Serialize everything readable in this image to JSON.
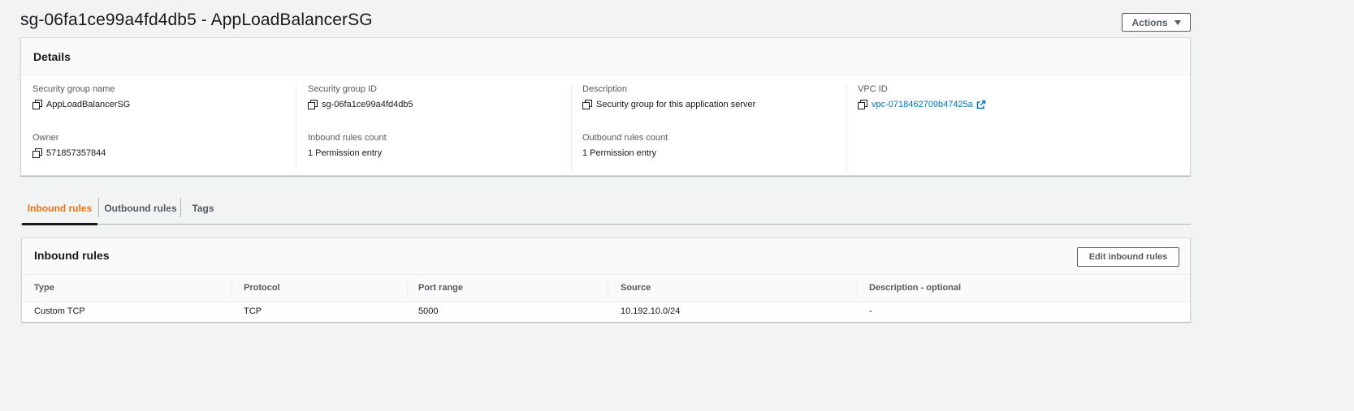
{
  "header": {
    "title": "sg-06fa1ce99a4fd4db5 - AppLoadBalancerSG",
    "actions_label": "Actions"
  },
  "details": {
    "title": "Details",
    "fields": {
      "sg_name": {
        "label": "Security group name",
        "value": "AppLoadBalancerSG"
      },
      "sg_id": {
        "label": "Security group ID",
        "value": "sg-06fa1ce99a4fd4db5"
      },
      "description": {
        "label": "Description",
        "value": "Security group for this application server"
      },
      "vpc_id": {
        "label": "VPC ID",
        "value": "vpc-0718462709b47425a"
      },
      "owner": {
        "label": "Owner",
        "value": "571857357844"
      },
      "inbound_count": {
        "label": "Inbound rules count",
        "value": "1 Permission entry"
      },
      "outbound_count": {
        "label": "Outbound rules count",
        "value": "1 Permission entry"
      }
    }
  },
  "tabs": [
    {
      "label": "Inbound rules",
      "active": true
    },
    {
      "label": "Outbound rules",
      "active": false
    },
    {
      "label": "Tags",
      "active": false
    }
  ],
  "inbound_rules": {
    "title": "Inbound rules",
    "edit_label": "Edit inbound rules",
    "columns": [
      "Type",
      "Protocol",
      "Port range",
      "Source",
      "Description - optional"
    ],
    "rows": [
      [
        "Custom TCP",
        "TCP",
        "5000",
        "10.192.10.0/24",
        "-"
      ]
    ]
  },
  "colors": {
    "accent": "#ec7211",
    "link": "#0073bb",
    "text": "#16191f",
    "muted": "#545b64"
  }
}
